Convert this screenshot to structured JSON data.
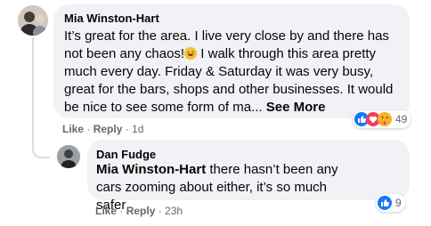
{
  "comment": {
    "author": "Mia Winston-Hart",
    "text_before_emoji": "It’s great for the area. I live very close by and there has not been any chaos!",
    "text_after_emoji": " I walk through this area pretty much every day. Friday & Saturday it was very busy, great for the bars, shops and other businesses. It would be nice to see some form of ma...",
    "see_more_label": "See More",
    "like_label": "Like",
    "reply_label": "Reply",
    "separator": " · ",
    "timestamp": "1d",
    "reaction_count": "49",
    "reaction_icons": [
      "like-icon",
      "love-icon",
      "care-icon"
    ]
  },
  "reply": {
    "author": "Dan Fudge",
    "mention": "Mia Winston-Hart",
    "text": " there hasn’t been any cars zooming about either, it’s so much safer",
    "like_label": "Like",
    "reply_label": "Reply",
    "separator": " · ",
    "timestamp": "23h",
    "reaction_count": "9",
    "reaction_icons": [
      "like-icon"
    ]
  },
  "colors": {
    "bubble": "#f0f2f5",
    "meta_text": "#65676b",
    "like_blue": "#1877f2",
    "love_red": "#f33e58"
  }
}
